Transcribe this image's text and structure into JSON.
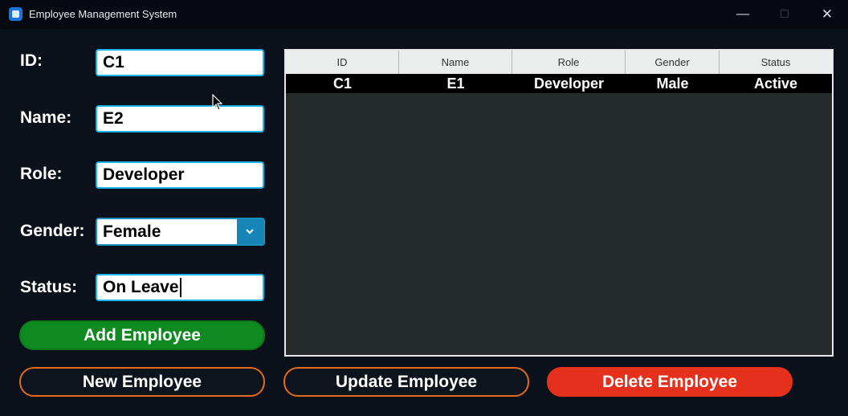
{
  "window": {
    "title": "Employee Management System",
    "minimize_icon": "minimize-icon",
    "maximize_icon": "maximize-icon",
    "close_icon": "close-icon"
  },
  "form": {
    "id_label": "ID:",
    "id_value": "C1",
    "name_label": "Name:",
    "name_value": "E2",
    "role_label": "Role:",
    "role_value": "Developer",
    "gender_label": "Gender:",
    "gender_value": "Female",
    "status_label": "Status:",
    "status_value": "On Leave"
  },
  "buttons": {
    "add": "Add Employee",
    "new": "New Employee",
    "update": "Update Employee",
    "delete": "Delete Employee"
  },
  "table": {
    "columns": [
      "ID",
      "Name",
      "Role",
      "Gender",
      "Status"
    ],
    "rows": [
      [
        "C1",
        "E1",
        "Developer",
        "Male",
        "Active"
      ]
    ]
  },
  "colors": {
    "background": "#0b111b",
    "input_border": "#1bb7e8",
    "add_button": "#0f8a20",
    "outline_button_border": "#e46a1a",
    "delete_button": "#e5311c",
    "table_background": "#252b2b",
    "selected_row": "#000000"
  }
}
